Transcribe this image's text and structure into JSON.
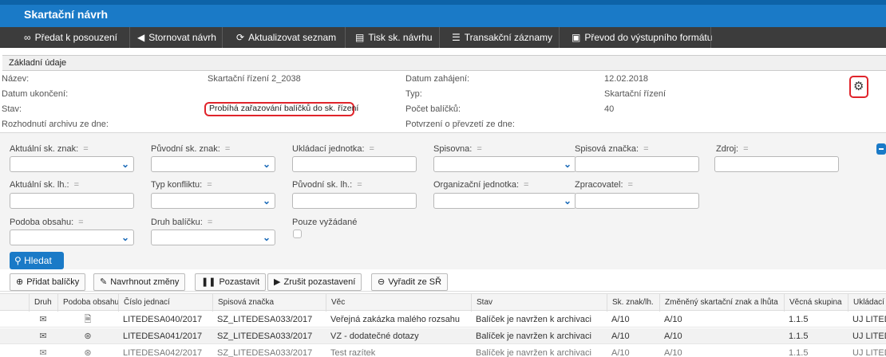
{
  "window": {
    "title": "Skartační návrh"
  },
  "toolbar": [
    {
      "icon": "link-icon",
      "glyph": "∞",
      "label": "Předat k posouzení"
    },
    {
      "icon": "arrow-left-icon",
      "glyph": "◀",
      "label": "Stornovat návrh"
    },
    {
      "icon": "refresh-icon",
      "glyph": "⟳",
      "label": "Aktualizovat seznam"
    },
    {
      "icon": "print-icon",
      "glyph": "▤",
      "label": "Tisk sk. návrhu"
    },
    {
      "icon": "list-icon",
      "glyph": "☰",
      "label": "Transakční záznamy"
    },
    {
      "icon": "export-icon",
      "glyph": "▣",
      "label": "Převod do výstupního formátu"
    }
  ],
  "basic": {
    "heading": "Základní údaje",
    "fields": {
      "nazev_label": "Název:",
      "nazev_value": "Skartační řízení 2_2038",
      "datum_ukonceni_label": "Datum ukončení:",
      "stav_label": "Stav:",
      "stav_value": "Probíhá zařazování balíčků do sk. řízení",
      "rozhodnuti_label": "Rozhodnutí archivu ze dne:",
      "datum_zahajeni_label": "Datum zahájení:",
      "datum_zahajeni_value": "12.02.2018",
      "typ_label": "Typ:",
      "typ_value": "Skartační řízení",
      "pocet_label": "Počet balíčků:",
      "pocet_value": "40",
      "potvrzeni_label": "Potvrzení o převzetí ze dne:"
    }
  },
  "filters": {
    "eq": "=",
    "aktualni_znak": "Aktuální sk. znak:",
    "puvodni_znak": "Původní sk. znak:",
    "ukladaci_jednotka": "Ukládací jednotka:",
    "spisovna": "Spisovna:",
    "spisova_znacka": "Spisová značka:",
    "zdroj": "Zdroj:",
    "aktualni_lh": "Aktuální sk. lh.:",
    "typ_konfliktu": "Typ konfliktu:",
    "puvodni_lh": "Původní sk. lh.:",
    "organizacni_jednotka": "Organizační jednotka:",
    "zpracovatel": "Zpracovatel:",
    "podoba_obsahu": "Podoba obsahu:",
    "druh_balicku": "Druh balíčku:",
    "pouze_vyzadane": "Pouze vyžádané",
    "search": "Hledat"
  },
  "actions": [
    {
      "icon": "add-package-icon",
      "glyph": "⊕",
      "label": "Přidat balíčky"
    },
    {
      "icon": "edit-icon",
      "glyph": "✎",
      "label": "Navrhnout změny"
    },
    {
      "icon": "pause-icon",
      "glyph": "❚❚",
      "label": "Pozastavit"
    },
    {
      "icon": "play-icon",
      "glyph": "▶",
      "label": "Zrušit pozastavení"
    },
    {
      "icon": "remove-icon",
      "glyph": "⊖",
      "label": "Vyřadit ze SŘ"
    }
  ],
  "table": {
    "columns": [
      "Druh",
      "Podoba obsahu",
      "Číslo jednací",
      "Spisová značka",
      "Věc",
      "Stav",
      "Sk. znak/lh.",
      "Změněný skartační znak a lhůta",
      "Věcná skupina",
      "Ukládací"
    ],
    "rows": [
      {
        "druh": "✉",
        "podoba": "🗎",
        "cislo": "LITEDESA040/2017",
        "znacka": "SZ_LITEDESA033/2017",
        "vec": "Veřejná zakázka malého rozsahu",
        "stav": "Balíček je navržen k archivaci",
        "znak": "A/10",
        "zmeneny": "A/10",
        "skupina": "1.1.5",
        "ukladaci": "UJ LITEDESA"
      },
      {
        "druh": "✉",
        "podoba": "⊛",
        "cislo": "LITEDESA041/2017",
        "znacka": "SZ_LITEDESA033/2017",
        "vec": "VZ - dodatečné dotazy",
        "stav": "Balíček je navržen k archivaci",
        "znak": "A/10",
        "zmeneny": "A/10",
        "skupina": "1.1.5",
        "ukladaci": "UJ LITEDESA"
      },
      {
        "druh": "✉",
        "podoba": "⊛",
        "cislo": "LITEDESA042/2017",
        "znacka": "SZ_LITEDESA033/2017",
        "vec": "Test razítek",
        "stav": "Balíček je navržen k archivaci",
        "znak": "A/10",
        "zmeneny": "A/10",
        "skupina": "1.1.5",
        "ukladaci": "UJ LITEDESA"
      }
    ]
  }
}
